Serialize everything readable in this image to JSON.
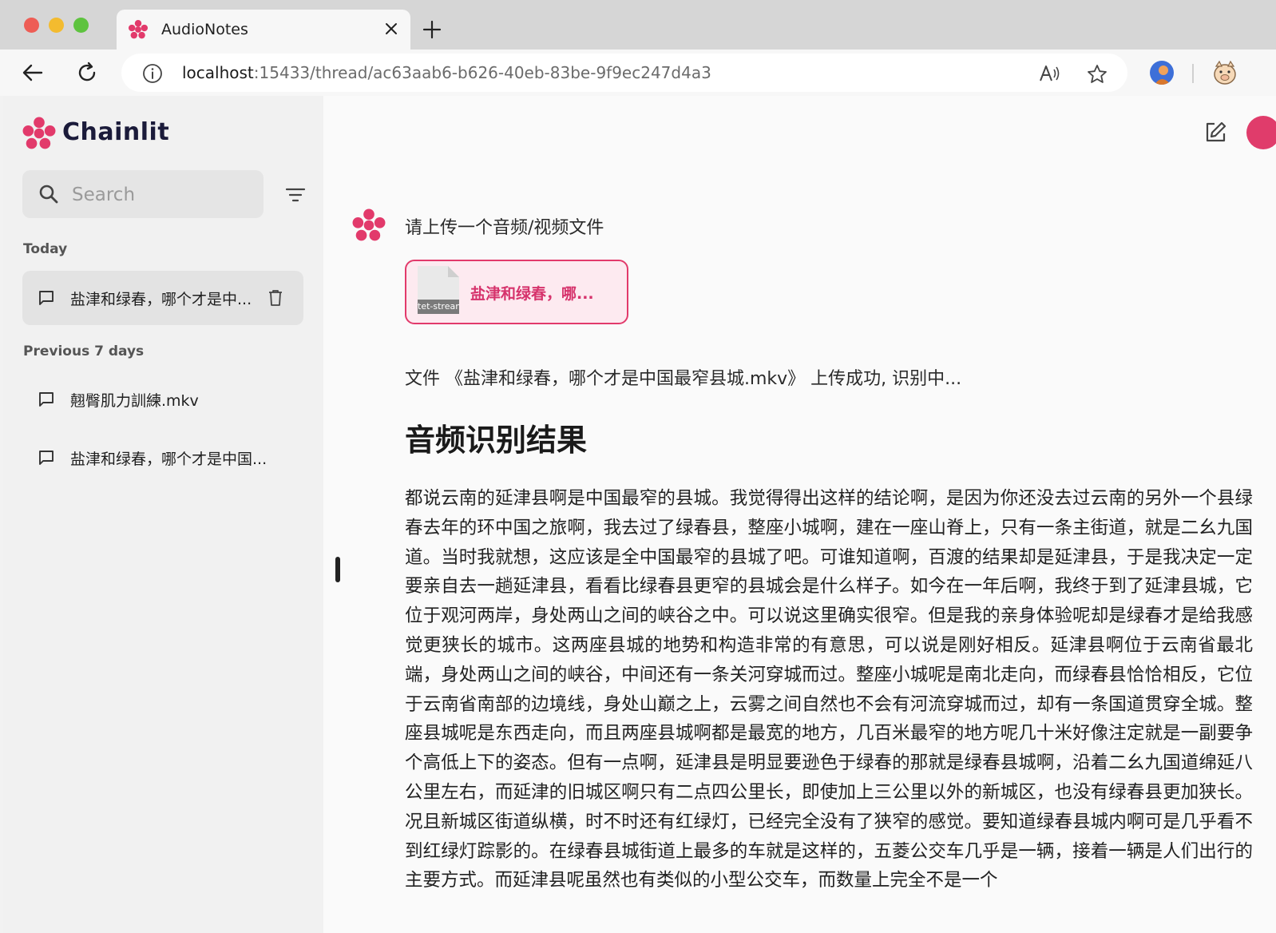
{
  "browser": {
    "tab_title": "AudioNotes",
    "url_host": "localhost",
    "url_path": ":15433/thread/ac63aab6-b626-40eb-83be-9f9ec247d4a3"
  },
  "sidebar": {
    "brand": "Chainlit",
    "search_placeholder": "Search",
    "sections": [
      {
        "label": "Today",
        "threads": [
          {
            "label": "盐津和绿春，哪个才是中..."
          }
        ]
      },
      {
        "label": "Previous 7 days",
        "threads": [
          {
            "label": "翹臀肌力訓練.mkv"
          },
          {
            "label": "盐津和绿春，哪个才是中国..."
          }
        ]
      }
    ]
  },
  "chat": {
    "prompt_message": "请上传一个音频/视频文件",
    "file_card": {
      "thumb_label": "tet-stream",
      "name": "盐津和绿春，哪..."
    },
    "upload_status": "文件 《盐津和绿春，哪个才是中国最窄县城.mkv》 上传成功, 识别中...",
    "result_heading": "音频识别结果",
    "transcript": "都说云南的延津县啊是中国最窄的县城。我觉得得出这样的结论啊，是因为你还没去过云南的另外一个县绿春去年的环中国之旅啊，我去过了绿春县，整座小城啊，建在一座山脊上，只有一条主街道，就是二幺九国道。当时我就想，这应该是全中国最窄的县城了吧。可谁知道啊，百渡的结果却是延津县，于是我决定一定要亲自去一趟延津县，看看比绿春县更窄的县城会是什么样子。如今在一年后啊，我终于到了延津县城，它位于观河两岸，身处两山之间的峡谷之中。可以说这里确实很窄。但是我的亲身体验呢却是绿春才是给我感觉更狭长的城市。这两座县城的地势和构造非常的有意思，可以说是刚好相反。延津县啊位于云南省最北端，身处两山之间的峡谷，中间还有一条关河穿城而过。整座小城呢是南北走向，而绿春县恰恰相反，它位于云南省南部的边境线，身处山巅之上，云雾之间自然也不会有河流穿城而过，却有一条国道贯穿全城。整座县城呢是东西走向，而且两座县城啊都是最宽的地方，几百米最窄的地方呢几十米好像注定就是一副要争个高低上下的姿态。但有一点啊，延津县是明显要逊色于绿春的那就是绿春县城啊，沿着二幺九国道绵延八公里左右，而延津的旧城区啊只有二点四公里长，即使加上三公里以外的新城区，也没有绿春县更加狭长。况且新城区街道纵横，时不时还有红绿灯，已经完全没有了狭窄的感觉。要知道绿春县城内啊可是几乎看不到红绿灯踪影的。在绿春县城街道上最多的车就是这样的，五菱公交车几乎是一辆，接着一辆是人们出行的主要方式。而延津县呢虽然也有类似的小型公交车，而数量上完全不是一个"
  },
  "colors": {
    "brand_pink": "#e23a6b",
    "brand_navy": "#1b1b3a",
    "file_name": "#d6336c"
  }
}
